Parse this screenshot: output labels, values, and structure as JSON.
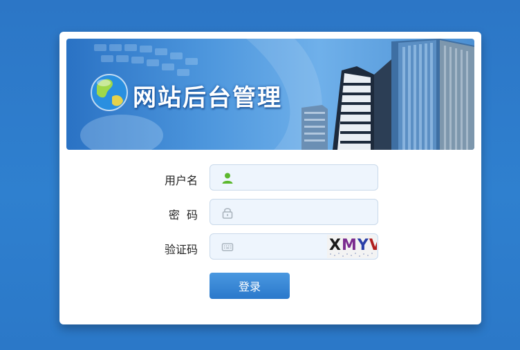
{
  "banner": {
    "title": "网站后台管理",
    "icons": [
      "globe-icon"
    ]
  },
  "form": {
    "username": {
      "label": "用户名",
      "value": "",
      "icon": "user-icon",
      "icon_color": "#5cb82e"
    },
    "password": {
      "label": "密  码",
      "value": "",
      "icon": "lock-icon"
    },
    "captcha": {
      "label": "验证码",
      "value": "",
      "icon": "keyboard-icon",
      "image_text": [
        "X",
        "M",
        "Y",
        "V"
      ]
    },
    "submit_label": "登录"
  },
  "colors": {
    "page_background": "#2c78c8",
    "button": "#2a78cb",
    "field_background": "#eef5fd"
  }
}
